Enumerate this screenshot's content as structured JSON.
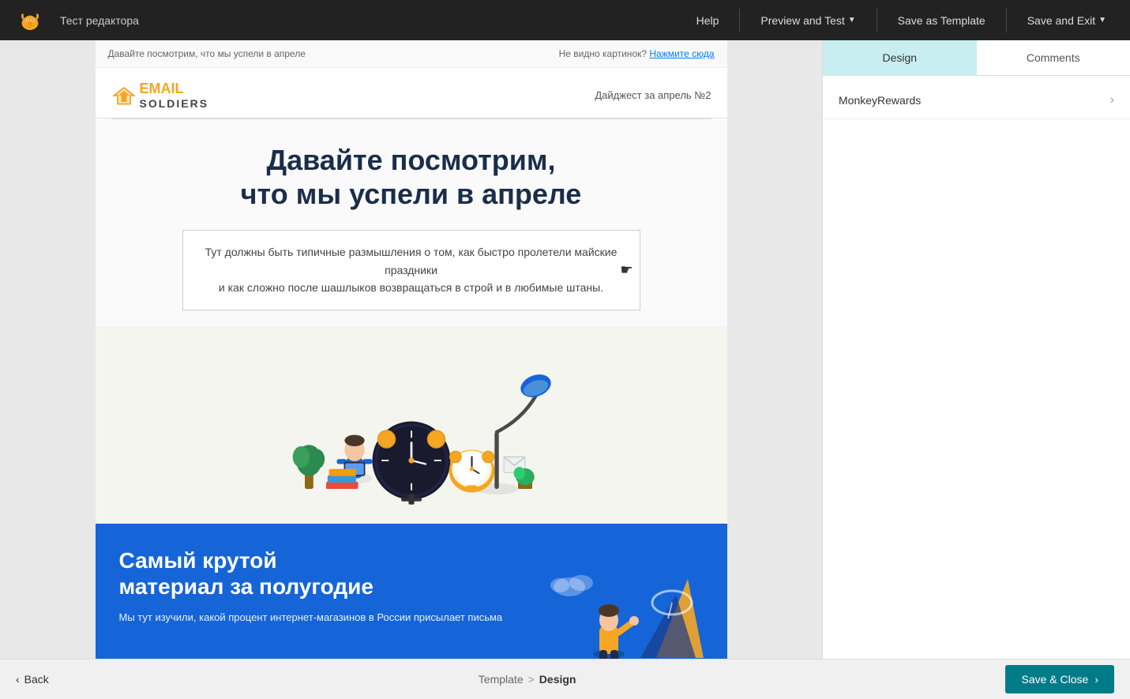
{
  "topNav": {
    "title": "Тест редактора",
    "helpLabel": "Help",
    "previewLabel": "Preview and Test",
    "saveTemplateLabel": "Save as Template",
    "saveExitLabel": "Save and Exit"
  },
  "emailPreview": {
    "preheader": {
      "text": "Давайте посмотрим, что мы успели в апреле",
      "imageNote": "Не видно картинок?",
      "imageLink": "Нажмите сюда"
    },
    "header": {
      "logoTextLine1": "EMAIL",
      "logoTextLine2": "SOLDIERS",
      "digestLabel": "Дайджест за апрель №2"
    },
    "hero": {
      "title": "Давайте посмотрим,\nчто мы успели в апреле",
      "bodyText": "Тут должны быть типичные размышления о том, как быстро пролетели майские праздники\nи как сложно после шашлыков возвращаться в строй и в любимые штаны."
    },
    "blueSection": {
      "title": "Самый крутой\nматериал за полугодие",
      "body": "Мы тут изучили, какой процент интернет-магазинов в России присылает письма"
    }
  },
  "rightPanel": {
    "tabs": [
      {
        "label": "Design",
        "active": true
      },
      {
        "label": "Comments",
        "active": false
      }
    ],
    "sections": [
      {
        "label": "MonkeyRewards"
      }
    ]
  },
  "bottomBar": {
    "backLabel": "Back",
    "breadcrumb": {
      "template": "Template",
      "separator": ">",
      "current": "Design"
    },
    "saveCloseLabel": "Save & Close"
  }
}
